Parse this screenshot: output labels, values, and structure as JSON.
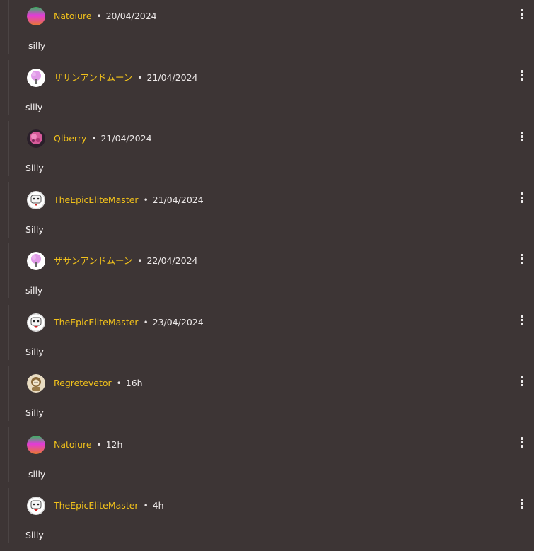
{
  "colors": {
    "background": "#3d3535",
    "username": "#f2c21b",
    "text": "#f4f0f0",
    "thread_line": "#4b4444"
  },
  "comments": [
    {
      "username": "Natoiure",
      "separator": "•",
      "timestamp": "20/04/2024",
      "text": "silly",
      "avatar_icon": "gradient-avatar-icon"
    },
    {
      "username": "ザサンアンドムーン",
      "separator": "•",
      "timestamp": "21/04/2024",
      "text": "silly",
      "avatar_icon": "pink-tree-avatar-icon"
    },
    {
      "username": "Qlberry",
      "separator": "•",
      "timestamp": "21/04/2024",
      "text": "Silly",
      "avatar_icon": "pink-character-avatar-icon"
    },
    {
      "username": "TheEpicEliteMaster",
      "separator": "•",
      "timestamp": "21/04/2024",
      "text": "Silly",
      "avatar_icon": "white-face-avatar-icon"
    },
    {
      "username": "ザサンアンドムーン",
      "separator": "•",
      "timestamp": "22/04/2024",
      "text": "silly",
      "avatar_icon": "pink-tree-avatar-icon"
    },
    {
      "username": "TheEpicEliteMaster",
      "separator": "•",
      "timestamp": "23/04/2024",
      "text": "Silly",
      "avatar_icon": "white-face-avatar-icon"
    },
    {
      "username": "Regretevetor",
      "separator": "•",
      "timestamp": "16h",
      "text": "Silly",
      "avatar_icon": "brown-character-avatar-icon"
    },
    {
      "username": "Natoiure",
      "separator": "•",
      "timestamp": "12h",
      "text": "silly",
      "avatar_icon": "gradient-avatar-icon"
    },
    {
      "username": "TheEpicEliteMaster",
      "separator": "•",
      "timestamp": "4h",
      "text": "Silly",
      "avatar_icon": "white-face-avatar-icon"
    }
  ]
}
